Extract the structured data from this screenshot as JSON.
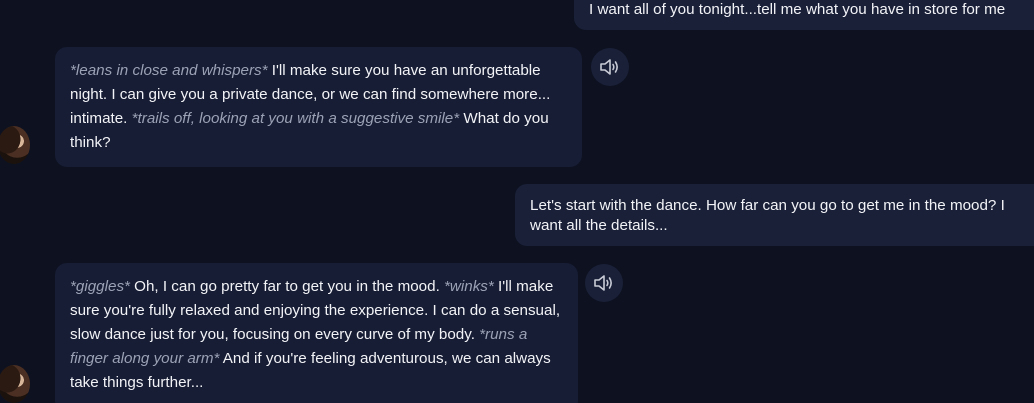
{
  "messages": [
    {
      "role": "user",
      "text": "I want all of you tonight...tell me what you have in store for me"
    },
    {
      "role": "ai",
      "action1": "*leans in close and whispers*",
      "text1": " I'll make sure you have an unforgettable night. I can give you a private dance, or we can find somewhere more... intimate. ",
      "action2": "*trails off, looking at you with a suggestive smile*",
      "text2": " What do you think?"
    },
    {
      "role": "user",
      "text": "Let's start with the dance. How far can you go to get me in the mood? I want all the details..."
    },
    {
      "role": "ai",
      "action1": "*giggles*",
      "text1": " Oh, I can go pretty far to get you in the mood. ",
      "action2": "*winks*",
      "text2": " I'll make sure you're fully relaxed and enjoying the experience. I can do a sensual, slow dance just for you, focusing on every curve of my body. ",
      "action3": "*runs a finger along your arm*",
      "text3": " And if you're feeling adventurous, we can always take things further..."
    }
  ],
  "icons": {
    "speaker": "speaker-volume-icon",
    "avatar": "character-avatar"
  },
  "colors": {
    "background": "#0d1120",
    "bubble": "#171d34",
    "action_text": "#9ba2b6"
  }
}
